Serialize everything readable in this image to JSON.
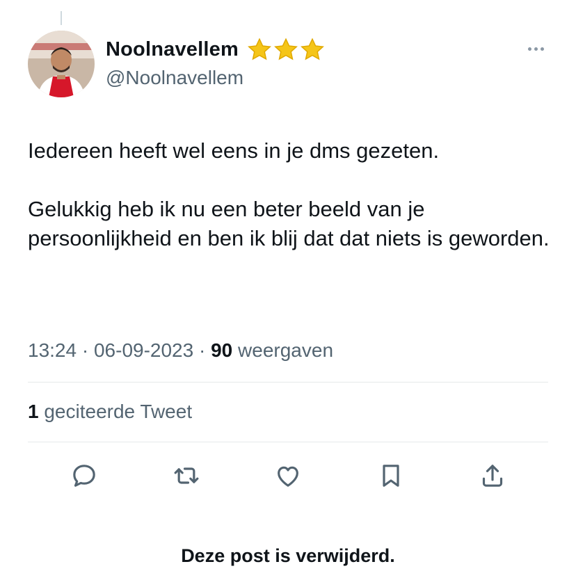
{
  "tweet": {
    "display_name": "Noolnavellem",
    "handle": "@Noolnavellem",
    "name_badge_icons": [
      "star-icon",
      "star-icon",
      "star-icon"
    ],
    "paragraphs": [
      "Iedereen heeft wel eens in je dms gezeten.",
      "Gelukkig heb ik nu een beter beeld van je persoonlijkheid en ben ik blij dat dat niets is geworden."
    ],
    "time": "13:24",
    "date": "06-09-2023",
    "views_count": "90",
    "views_label": "weergaven",
    "separator": "·",
    "quote_count": "1",
    "quote_label": "geciteerde Tweet"
  },
  "actions": [
    {
      "name": "reply-icon"
    },
    {
      "name": "retweet-icon"
    },
    {
      "name": "like-icon"
    },
    {
      "name": "bookmark-icon"
    },
    {
      "name": "share-icon"
    }
  ],
  "notice": {
    "text": "Deze post is verwijderd."
  },
  "colors": {
    "text": "#0f1419",
    "secondary": "#536471",
    "divider": "#e6e9ea",
    "star": "#f5c518"
  }
}
